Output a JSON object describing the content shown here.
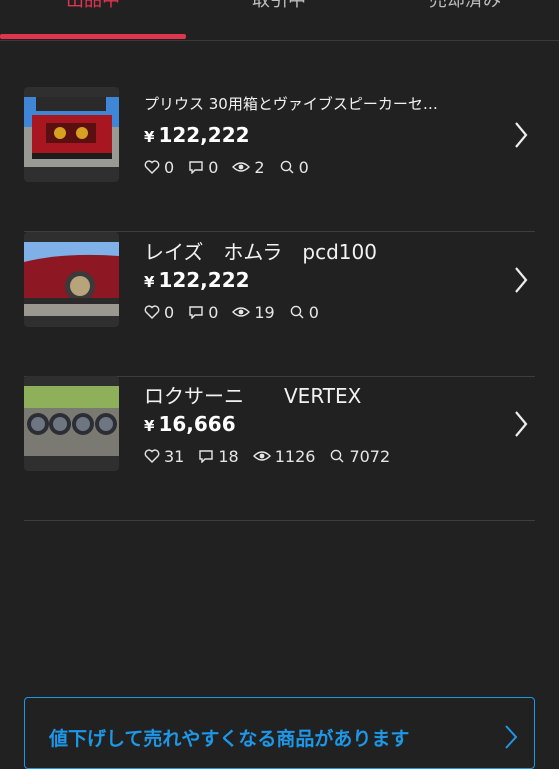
{
  "tabs": [
    {
      "label": "出品中",
      "active": true
    },
    {
      "label": "取引中",
      "active": false
    },
    {
      "label": "売却済み",
      "active": false
    }
  ],
  "accent_color": "#e0354f",
  "banner_color": "#1d97e8",
  "items": [
    {
      "title": "プリウス 30用箱とヴァイブスピーカーセ…",
      "currency": "¥",
      "price": "122,222",
      "likes": "0",
      "comments": "0",
      "views": "2",
      "searches": "0"
    },
    {
      "title": "レイズ　ホムラ　pcd100",
      "currency": "¥",
      "price": "122,222",
      "likes": "0",
      "comments": "0",
      "views": "19",
      "searches": "0"
    },
    {
      "title": "ロクサーニ　　VERTEX",
      "currency": "¥",
      "price": "16,666",
      "likes": "31",
      "comments": "18",
      "views": "1126",
      "searches": "7072"
    }
  ],
  "banner": {
    "text": "値下げして売れやすくなる商品があります"
  }
}
